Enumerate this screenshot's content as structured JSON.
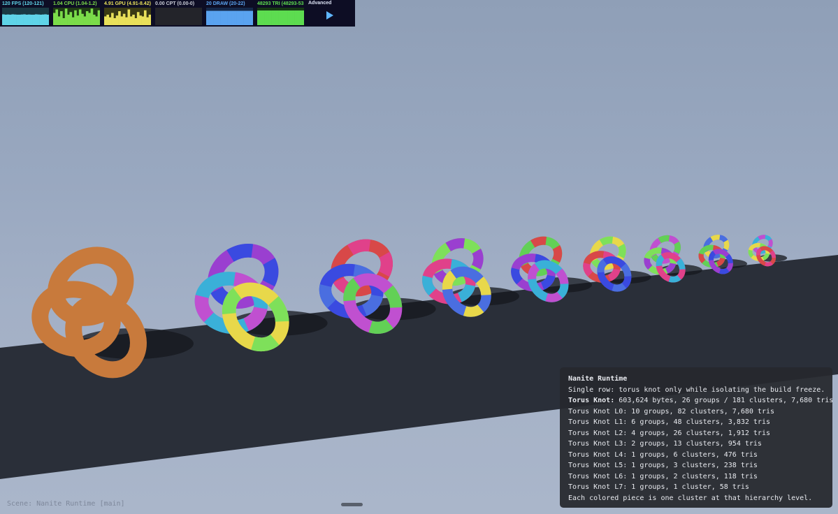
{
  "stats": {
    "panels": [
      {
        "label": "120 FPS (120-121)",
        "color": "#5fd4e8",
        "bg": "#1a3a44",
        "values": [
          0.62,
          0.6,
          0.61,
          0.6,
          0.62,
          0.61,
          0.6,
          0.6,
          0.61,
          0.62,
          0.6,
          0.61,
          0.6,
          0.6,
          0.62,
          0.61,
          0.6,
          0.61,
          0.62,
          0.6
        ]
      },
      {
        "label": "1.04 CPU (1.04-1.2)",
        "color": "#7bdc4a",
        "bg": "#1f3a14",
        "values": [
          0.7,
          0.9,
          0.5,
          0.8,
          0.4,
          0.95,
          0.6,
          0.75,
          0.45,
          0.85,
          0.55,
          0.9,
          0.65,
          0.5,
          0.8,
          0.7,
          0.95,
          0.6,
          0.5,
          0.85
        ]
      },
      {
        "label": "4.91 GPU (4.91-8.42)",
        "color": "#e8e05a",
        "bg": "#3a3a14",
        "values": [
          0.5,
          0.6,
          0.45,
          0.7,
          0.4,
          0.55,
          0.8,
          0.5,
          0.65,
          0.45,
          0.9,
          0.5,
          0.6,
          0.4,
          0.75,
          0.55,
          0.5,
          0.85,
          0.45,
          0.6
        ]
      },
      {
        "label": "0.00 CPT (0.00-0)",
        "color": "#c9ccd6",
        "bg": "#23242a",
        "values": [
          0,
          0,
          0,
          0,
          0,
          0,
          0,
          0,
          0,
          0,
          0,
          0,
          0,
          0,
          0,
          0,
          0,
          0,
          0,
          0
        ]
      },
      {
        "label": "20 DRAW (20-22)",
        "color": "#5aa3f0",
        "bg": "#15294a",
        "values": [
          0.82,
          0.82,
          0.82,
          0.82,
          0.82,
          0.82,
          0.82,
          0.82,
          0.82,
          0.82,
          0.82,
          0.82,
          0.82,
          0.82,
          0.82,
          0.82,
          0.82,
          0.82,
          0.82,
          0.82
        ]
      },
      {
        "label": "48293 TRI (48293-53",
        "color": "#5ddc50",
        "bg": "#163a14",
        "values": [
          0.84,
          0.84,
          0.84,
          0.84,
          0.84,
          0.84,
          0.84,
          0.84,
          0.84,
          0.84,
          0.84,
          0.84,
          0.84,
          0.84,
          0.84,
          0.84,
          0.84,
          0.84,
          0.84,
          0.84
        ]
      }
    ],
    "advanced_label": "Advanced"
  },
  "info": {
    "title": "Nanite Runtime",
    "lines": [
      "Single row: torus knot only while isolating the build freeze.",
      "Torus Knot L0: 10 groups, 82 clusters, 7,680 tris",
      "Torus Knot L1: 6 groups, 48 clusters, 3,832 tris",
      "Torus Knot L2: 4 groups, 26 clusters, 1,912 tris",
      "Torus Knot L3: 2 groups, 13 clusters, 954 tris",
      "Torus Knot L4: 1 groups, 6 clusters, 476 tris",
      "Torus Knot L5: 1 groups, 3 clusters, 238 tris",
      "Torus Knot L6: 1 groups, 2 clusters, 118 tris",
      "Torus Knot L7: 1 groups, 1 cluster, 58 tris",
      "Each colored piece is one cluster at that hierarchy level."
    ],
    "summary_label": "Torus Knot:",
    "summary_value": " 603,624 bytes, 26 groups / 181 clusters, 7,680 tris"
  },
  "status_text": "Scene: Nanite Runtime [main]",
  "scene": {
    "floor_color": "#2a2f39",
    "base_knot_color": "#c87a3c",
    "cluster_palette": [
      "#e0418a",
      "#4a6ee0",
      "#62d056",
      "#9a3fd0",
      "#3ab0d8",
      "#e8d84a",
      "#d84848",
      "#3a4ae0",
      "#c050d0",
      "#7ee05a"
    ]
  }
}
